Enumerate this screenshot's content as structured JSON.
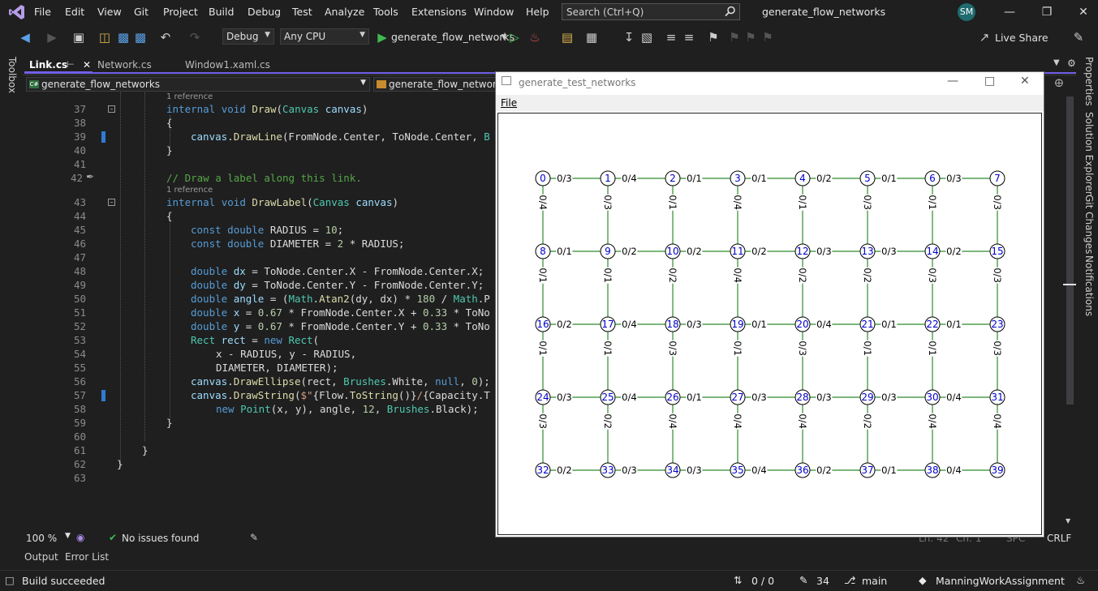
{
  "title_bar": {
    "menu": [
      "File",
      "Edit",
      "View",
      "Git",
      "Project",
      "Build",
      "Debug",
      "Test",
      "Analyze",
      "Tools",
      "Extensions",
      "Window",
      "Help"
    ],
    "search_placeholder": "Search (Ctrl+Q)",
    "solution_name": "generate_flow_networks",
    "avatar_initials": "SM"
  },
  "toolbar": {
    "configuration": "Debug",
    "platform": "Any CPU",
    "startup_project": "generate_flow_networks",
    "live_share": "Live Share"
  },
  "side_panels": {
    "left": "Toolbox",
    "right": [
      "Properties",
      "Solution Explorer",
      "Git Changes",
      "Notifications"
    ]
  },
  "tabs": [
    {
      "label": "Link.cs",
      "active": true
    },
    {
      "label": "Network.cs",
      "active": false
    },
    {
      "label": "Window1.xaml.cs",
      "active": false
    }
  ],
  "nav": {
    "project": "generate_flow_networks",
    "type": "generate_flow_networks."
  },
  "code": {
    "ref_hint": "1 reference",
    "lines": [
      {
        "n": "37",
        "text": "internal void Draw(Canvas canvas)"
      },
      {
        "n": "38",
        "text": "{"
      },
      {
        "n": "39",
        "text": "canvas.DrawLine(FromNode.Center, ToNode.Center, B"
      },
      {
        "n": "40",
        "text": "}"
      },
      {
        "n": "41",
        "text": ""
      },
      {
        "n": "42",
        "text": "// Draw a label along this link."
      },
      {
        "n": "43",
        "text": "internal void DrawLabel(Canvas canvas)"
      },
      {
        "n": "44",
        "text": "{"
      },
      {
        "n": "45",
        "text": "const double RADIUS = 10;"
      },
      {
        "n": "46",
        "text": "const double DIAMETER = 2 * RADIUS;"
      },
      {
        "n": "47",
        "text": ""
      },
      {
        "n": "48",
        "text": "double dx = ToNode.Center.X - FromNode.Center.X;"
      },
      {
        "n": "49",
        "text": "double dy = ToNode.Center.Y - FromNode.Center.Y;"
      },
      {
        "n": "50",
        "text": "double angle = (Math.Atan2(dy, dx) * 180 / Math.P"
      },
      {
        "n": "51",
        "text": "double x = 0.67 * FromNode.Center.X + 0.33 * ToNo"
      },
      {
        "n": "52",
        "text": "double y = 0.67 * FromNode.Center.Y + 0.33 * ToNo"
      },
      {
        "n": "53",
        "text": "Rect rect = new Rect("
      },
      {
        "n": "54",
        "text": "x - RADIUS, y - RADIUS,"
      },
      {
        "n": "55",
        "text": "DIAMETER, DIAMETER);"
      },
      {
        "n": "56",
        "text": "canvas.DrawEllipse(rect, Brushes.White, null, 0);"
      },
      {
        "n": "57",
        "text": "canvas.DrawString($\"{Flow.ToString()}/{Capacity.T"
      },
      {
        "n": "58",
        "text": "new Point(x, y), angle, 12, Brushes.Black);"
      },
      {
        "n": "59",
        "text": "}"
      },
      {
        "n": "60",
        "text": ""
      },
      {
        "n": "61",
        "text": "}"
      },
      {
        "n": "62",
        "text": "}"
      },
      {
        "n": "63",
        "text": ""
      }
    ]
  },
  "editor_status": {
    "zoom": "100 %",
    "issues": "No issues found",
    "line": "Ln: 42",
    "col": "Ch: 1",
    "spc": "SPC",
    "eol": "CRLF"
  },
  "bottom_tabs": [
    "Output",
    "Error List"
  ],
  "status_bar": {
    "build": "Build succeeded",
    "push_pull": "0 / 0",
    "pending": "34",
    "branch": "main",
    "repo": "ManningWorkAssignment"
  },
  "app_window": {
    "title": "generate_test_networks",
    "menu_file": "File",
    "network": {
      "rows": 5,
      "cols": 8,
      "node_ids": [
        "0",
        "1",
        "2",
        "3",
        "4",
        "5",
        "6",
        "7",
        "8",
        "9",
        "10",
        "11",
        "12",
        "13",
        "14",
        "15",
        "16",
        "17",
        "18",
        "19",
        "20",
        "21",
        "22",
        "23",
        "24",
        "25",
        "26",
        "27",
        "28",
        "29",
        "30",
        "31",
        "32",
        "33",
        "34",
        "35",
        "36",
        "37",
        "38",
        "39"
      ],
      "horizontal_labels": [
        [
          "0/3",
          "0/4",
          "0/1",
          "0/1",
          "0/2",
          "0/1",
          "0/3"
        ],
        [
          "0/1",
          "0/2",
          "0/2",
          "0/2",
          "0/3",
          "0/3",
          "0/2"
        ],
        [
          "0/2",
          "0/4",
          "0/3",
          "0/1",
          "0/4",
          "0/1",
          "0/1"
        ],
        [
          "0/3",
          "0/4",
          "0/1",
          "0/3",
          "0/3",
          "0/3",
          "0/4"
        ],
        [
          "0/2",
          "0/3",
          "0/3",
          "0/4",
          "0/2",
          "0/1",
          "0/4"
        ]
      ],
      "vertical_labels": [
        [
          "0/4",
          "0/3",
          "0/1",
          "0/4",
          "0/1",
          "0/3",
          "0/1",
          "0/3"
        ],
        [
          "0/1",
          "0/1",
          "0/2",
          "0/4",
          "0/2",
          "0/2",
          "0/3",
          "0/3"
        ],
        [
          "0/1",
          "0/1",
          "0/3",
          "0/1",
          "0/3",
          "0/1",
          "0/1",
          "0/3"
        ],
        [
          "0/3",
          "0/2",
          "0/4",
          "0/4",
          "0/4",
          "0/2",
          "0/4",
          "0/4"
        ]
      ],
      "edge_color": "#2e8b2e",
      "node_text_color": "#0000cc"
    }
  }
}
